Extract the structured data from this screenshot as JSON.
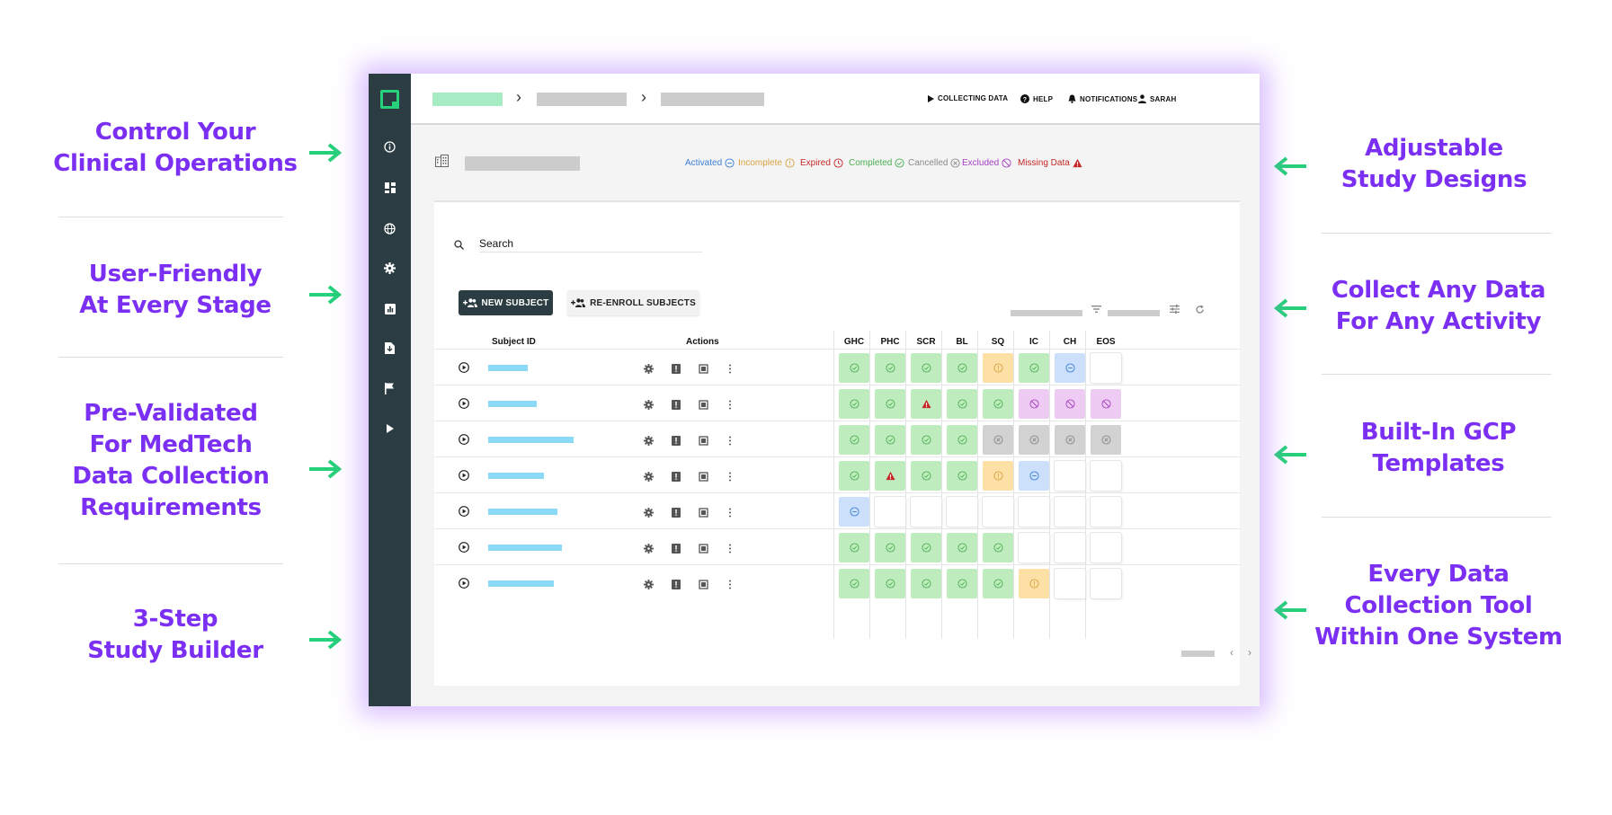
{
  "callouts_left": [
    {
      "id": "control",
      "text": "Control Your\nClinical Operations"
    },
    {
      "id": "user-friendly",
      "text": "User-Friendly\nAt Every Stage"
    },
    {
      "id": "pre-validated",
      "text": "Pre-Validated\nFor MedTech\nData Collection\nRequirements"
    },
    {
      "id": "study-builder",
      "text": "3-Step\nStudy Builder"
    }
  ],
  "callouts_right": [
    {
      "id": "adjustable",
      "text": "Adjustable\nStudy Designs"
    },
    {
      "id": "collect",
      "text": "Collect Any Data\nFor Any Activity"
    },
    {
      "id": "gcp",
      "text": "Built-In GCP\nTemplates"
    },
    {
      "id": "every-tool",
      "text": "Every Data\nCollection Tool\nWithin One System"
    }
  ],
  "colors": {
    "callout": "#7b2ff2",
    "arrow": "#27d07a",
    "sidebar": "#2b3d42",
    "completed": "#4caf50",
    "incomplete": "#d9a441",
    "activated": "#3b7fd6",
    "expired": "#c62828",
    "cancelled": "#8a8a8a",
    "excluded": "#a640c4",
    "missing": "#c62828"
  },
  "sidebar": {
    "items": [
      "info-icon",
      "dashboard-icon",
      "globe-icon",
      "gear-icon",
      "report-icon",
      "download-icon",
      "flag-icon",
      "play-icon"
    ]
  },
  "topnav": {
    "collecting": "COLLECTING DATA",
    "help": "HELP",
    "notifications": "NOTIFICATIONS",
    "user": "SARAH"
  },
  "legend": [
    {
      "key": "activated",
      "label": "Activated"
    },
    {
      "key": "incomplete",
      "label": "Incomplete"
    },
    {
      "key": "expired",
      "label": "Expired"
    },
    {
      "key": "completed",
      "label": "Completed"
    },
    {
      "key": "cancelled",
      "label": "Cancelled"
    },
    {
      "key": "excluded",
      "label": "Excluded"
    },
    {
      "key": "missing",
      "label": "Missing Data"
    }
  ],
  "search": {
    "placeholder": "Search"
  },
  "buttons": {
    "new_subject": "NEW SUBJECT",
    "re_enroll": "RE-ENROLL SUBJECTS"
  },
  "table": {
    "headers": {
      "subject_id": "Subject ID",
      "actions": "Actions"
    },
    "visit_columns": [
      "GHC",
      "PHC",
      "SCR",
      "BL",
      "SQ",
      "IC",
      "CH",
      "EOS"
    ],
    "rows": [
      {
        "cells": [
          "completed",
          "completed",
          "completed",
          "completed",
          "incomplete",
          "completed",
          "activated",
          "empty"
        ]
      },
      {
        "cells": [
          "completed",
          "completed",
          "missing",
          "completed",
          "completed",
          "excluded",
          "excluded",
          "excluded"
        ]
      },
      {
        "cells": [
          "completed",
          "completed",
          "completed",
          "completed",
          "cancelled",
          "cancelled",
          "cancelled",
          "cancelled"
        ]
      },
      {
        "cells": [
          "completed",
          "missing",
          "completed",
          "completed",
          "incomplete",
          "activated",
          "empty",
          "empty"
        ]
      },
      {
        "cells": [
          "activated",
          "empty",
          "empty",
          "empty",
          "empty",
          "empty",
          "empty",
          "empty"
        ]
      },
      {
        "cells": [
          "completed",
          "completed",
          "completed",
          "completed",
          "completed",
          "empty",
          "empty",
          "empty"
        ]
      },
      {
        "cells": [
          "completed",
          "completed",
          "completed",
          "completed",
          "completed",
          "incomplete",
          "empty",
          "empty"
        ]
      }
    ]
  },
  "pager": {
    "prev": "‹",
    "next": "›"
  }
}
